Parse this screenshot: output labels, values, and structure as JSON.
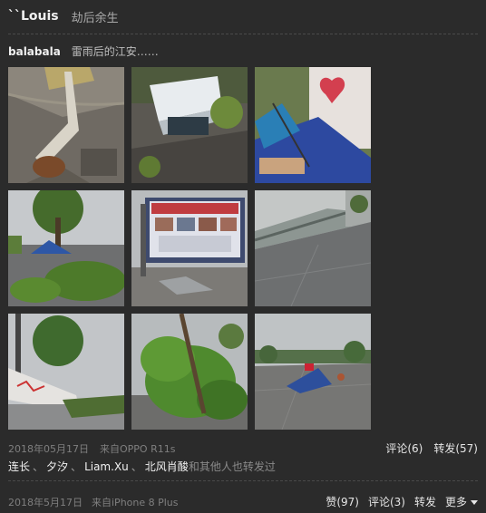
{
  "post": {
    "author": "``Louis",
    "status": "劫后余生"
  },
  "repost": {
    "author": "balabala",
    "text": "雷雨后的江安……",
    "photos": [
      {
        "name": "photo-fallen-tree-trunk"
      },
      {
        "name": "photo-knocked-over-vending-box"
      },
      {
        "name": "photo-collapsed-umbrella-stall"
      },
      {
        "name": "photo-street-fallen-tree-tent"
      },
      {
        "name": "photo-bulletin-board-shattered-glass"
      },
      {
        "name": "photo-collapsed-canopy"
      },
      {
        "name": "photo-damaged-gate-sign"
      },
      {
        "name": "photo-broken-tree-branches"
      },
      {
        "name": "photo-debris-on-plaza"
      }
    ],
    "date": "2018年05月17日",
    "source": "来自OPPO R11s",
    "comment_label": "评论(6)",
    "forward_label": "转发(57)"
  },
  "reposters": {
    "names": [
      "连长",
      "夕汐",
      "Liam.Xu",
      "北风",
      "肖酸"
    ],
    "suffix": "和其他人也转发过"
  },
  "footer": {
    "date": "2018年5月17日",
    "source": "来自iPhone 8 Plus",
    "like_label": "赞(97)",
    "comment_label": "评论(3)",
    "forward_label": "转发",
    "more_label": "更多"
  }
}
